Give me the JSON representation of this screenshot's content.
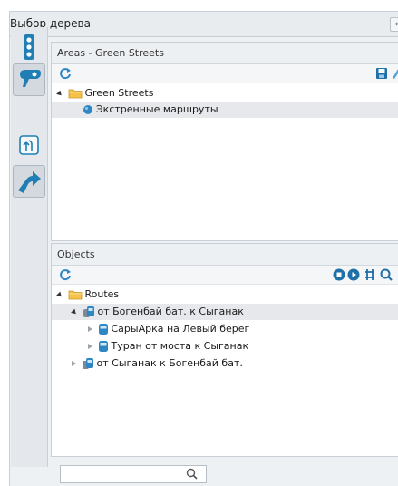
{
  "window": {
    "title": "Выбор дерева",
    "close_label": "«"
  },
  "rail": {
    "items": [
      {
        "name": "traffic-light-icon",
        "active": false
      },
      {
        "name": "pin-icon",
        "active": true
      },
      {
        "name": "route-fork-icon",
        "active": false
      },
      {
        "name": "turn-arrow-icon",
        "active": true
      }
    ]
  },
  "areas": {
    "title": "Areas - Green Streets",
    "tree": [
      {
        "label": "Green Streets",
        "icon": "folder-icon"
      },
      {
        "label": "Экстренные маршруты",
        "icon": "circle-icon"
      }
    ]
  },
  "objects": {
    "title": "Objects",
    "tree": [
      {
        "label": "Routes",
        "icon": "folder-icon"
      },
      {
        "label": "от Богенбай бат. к Сыганак",
        "icon": "bus-stack-icon"
      },
      {
        "label": "СарыАрка на Левый берег",
        "icon": "bus-icon"
      },
      {
        "label": "Туран от моста к Сыганак",
        "icon": "bus-icon"
      },
      {
        "label": "от Сыганак к Богенбай бат.",
        "icon": "bus-stack-icon"
      }
    ]
  },
  "search": {
    "placeholder": "",
    "value": ""
  }
}
